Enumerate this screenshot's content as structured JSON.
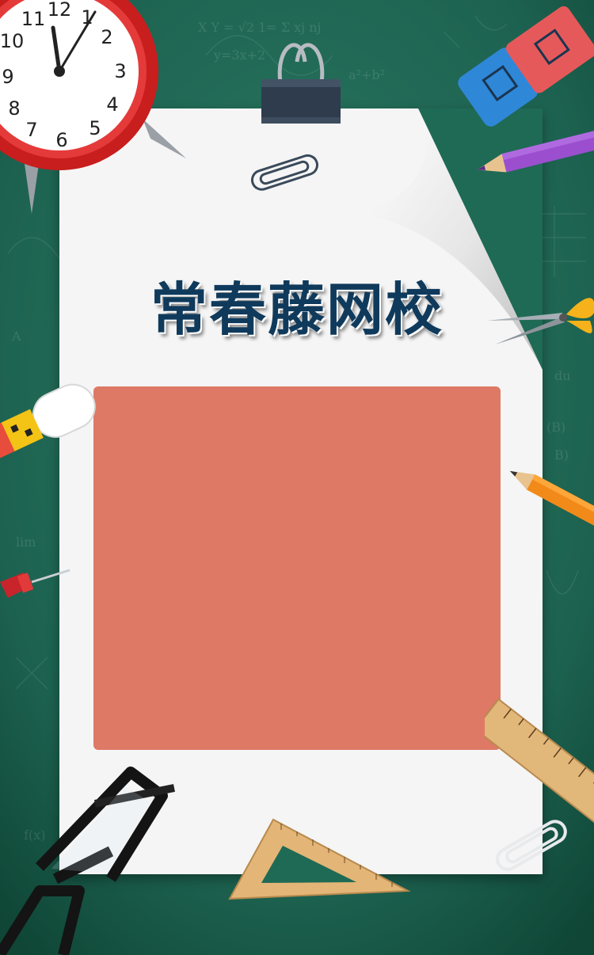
{
  "poster": {
    "title": "常春藤网校",
    "colors": {
      "board": "#1f6a55",
      "board_dark": "#0f4a3a",
      "paper": "#f5f5f5",
      "title": "#0f3a5c",
      "panel": "#de7966"
    }
  },
  "clock": {
    "numerals": [
      "12",
      "1",
      "2",
      "3",
      "4",
      "5",
      "6",
      "7",
      "8",
      "9",
      "10",
      "11"
    ]
  },
  "decorations": [
    "alarm-clock-icon",
    "binder-clip-icon",
    "paper-clip-icon",
    "eraser-icon",
    "pencil-icon",
    "scissors-icon",
    "usb-drive-icon",
    "push-pin-icon",
    "eyeglasses-icon",
    "ruler-icon",
    "set-square-icon"
  ]
}
